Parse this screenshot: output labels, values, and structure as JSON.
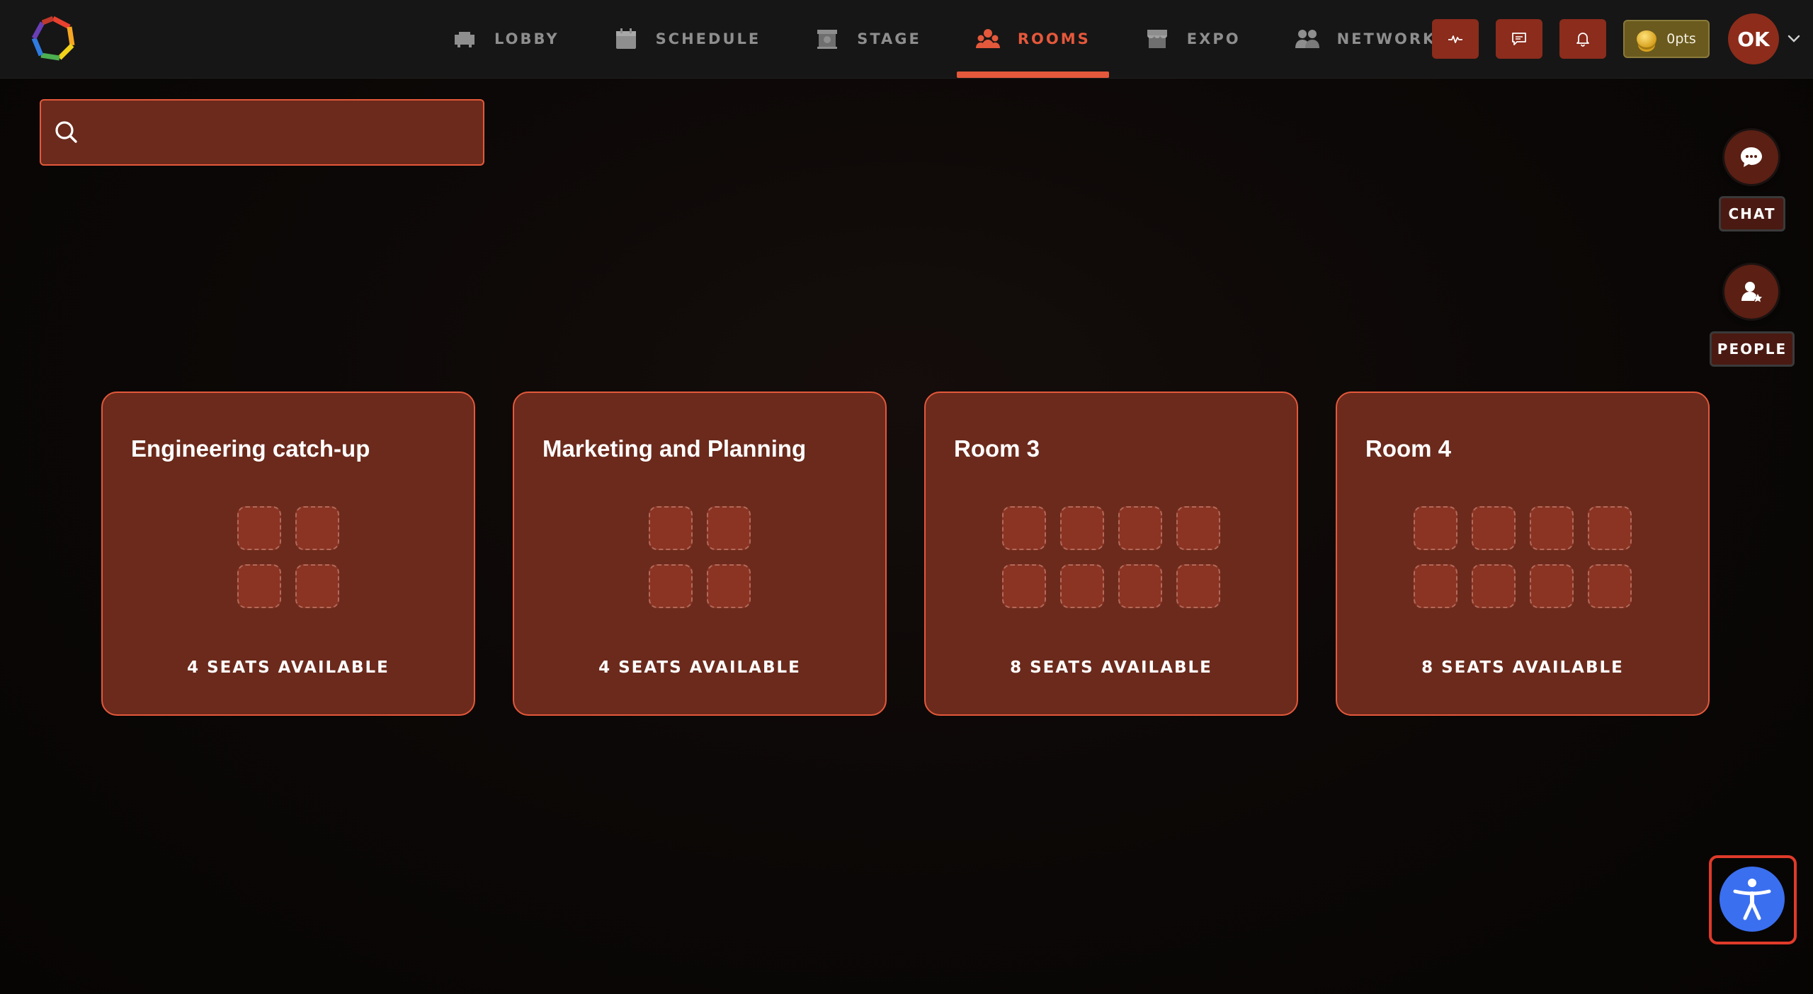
{
  "nav": {
    "items": [
      {
        "label": "LOBBY",
        "icon": "sofa-icon"
      },
      {
        "label": "SCHEDULE",
        "icon": "calendar-icon"
      },
      {
        "label": "STAGE",
        "icon": "stage-icon"
      },
      {
        "label": "ROOMS",
        "icon": "people-group-icon",
        "active": true
      },
      {
        "label": "EXPO",
        "icon": "store-icon"
      },
      {
        "label": "NETWORKING",
        "icon": "networking-icon"
      }
    ],
    "active_color": "#e4583b",
    "inactive_color": "#8e8e8e"
  },
  "top_actions": {
    "activity_icon": "pulse-icon",
    "messages_icon": "message-icon",
    "notifications_icon": "bell-icon",
    "points_label": "0pts",
    "avatar_initials": "OK"
  },
  "search": {
    "placeholder": "",
    "value": ""
  },
  "side": {
    "chat_label": "CHAT",
    "people_label": "PEOPLE"
  },
  "rooms": [
    {
      "name": "Engineering catch-up",
      "seats": 4,
      "seats_label": "4 SEATS AVAILABLE"
    },
    {
      "name": "Marketing and Planning",
      "seats": 4,
      "seats_label": "4 SEATS AVAILABLE"
    },
    {
      "name": "Room 3",
      "seats": 8,
      "seats_label": "8 SEATS AVAILABLE"
    },
    {
      "name": "Room 4",
      "seats": 8,
      "seats_label": "8 SEATS AVAILABLE"
    }
  ],
  "colors": {
    "accent": "#e4583b",
    "card_bg": "#6b2a1c",
    "accessibility_button": "#3a6ff0"
  }
}
